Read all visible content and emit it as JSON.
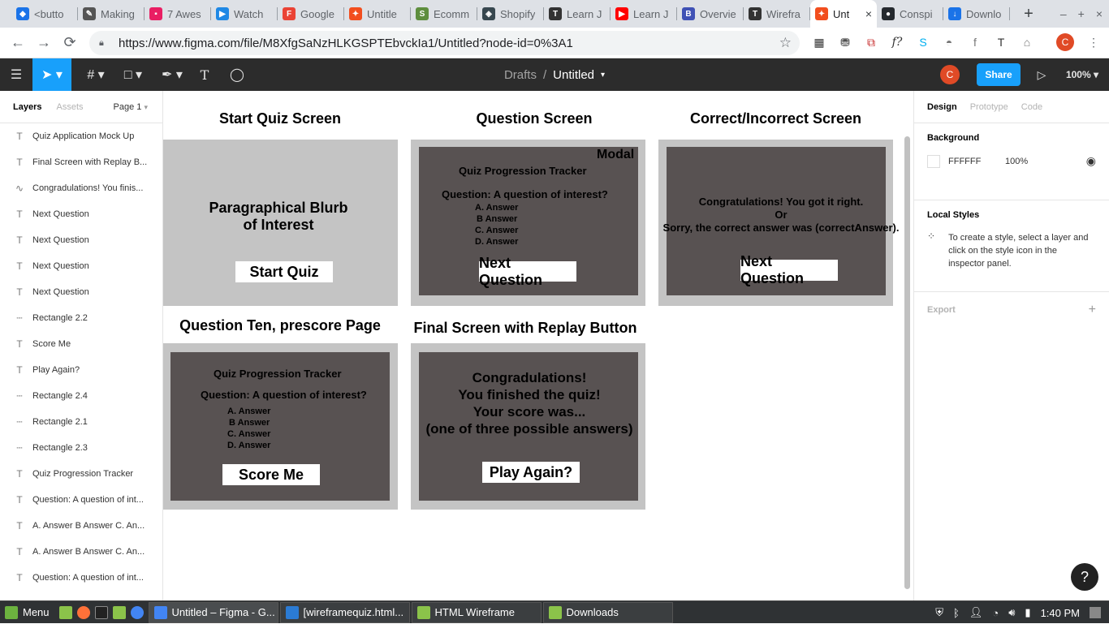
{
  "browser": {
    "tabs": [
      {
        "title": "<butto",
        "color": "#1a73e8",
        "glyph": "◆"
      },
      {
        "title": "Making",
        "color": "#555555",
        "glyph": "✎"
      },
      {
        "title": "7 Awes",
        "color": "#e91e63",
        "glyph": "▪"
      },
      {
        "title": "Watch",
        "color": "#1e88e5",
        "glyph": "▶"
      },
      {
        "title": "Google",
        "color": "#ea4335",
        "glyph": "F"
      },
      {
        "title": "Untitle",
        "color": "#f24e1e",
        "glyph": "✦"
      },
      {
        "title": "Ecomm",
        "color": "#5e8e3e",
        "glyph": "S"
      },
      {
        "title": "Shopify",
        "color": "#37474f",
        "glyph": "◈"
      },
      {
        "title": "Learn J",
        "color": "#333333",
        "glyph": "T"
      },
      {
        "title": "Learn J",
        "color": "#ff0000",
        "glyph": "▶"
      },
      {
        "title": "Overvie",
        "color": "#3f51b5",
        "glyph": "B"
      },
      {
        "title": "Wirefra",
        "color": "#333333",
        "glyph": "T"
      },
      {
        "title": "Unt",
        "color": "#f24e1e",
        "glyph": "✦",
        "active": true
      },
      {
        "title": "Conspi",
        "color": "#24292e",
        "glyph": "●"
      },
      {
        "title": "Downlo",
        "color": "#1a73e8",
        "glyph": "↓"
      }
    ],
    "url": "https://www.figma.com/file/M8XfgSaNzHLKGSPTEbvckIa1/Untitled?node-id=0%3A1",
    "close_tab": "×",
    "new_tab": "+",
    "win_min": "–",
    "win_max": "+",
    "win_close": "×"
  },
  "figma": {
    "breadcrumb_drafts": "Drafts",
    "breadcrumb_sep": "/",
    "file_name": "Untitled",
    "avatar_letter": "C",
    "share_label": "Share",
    "zoom": "100%"
  },
  "left_panel": {
    "tab_layers": "Layers",
    "tab_assets": "Assets",
    "page": "Page 1",
    "layers": [
      {
        "type": "text",
        "name": "Quiz Application Mock Up"
      },
      {
        "type": "text",
        "name": "Final Screen with Replay B..."
      },
      {
        "type": "vector",
        "name": "Congradulations! You finis..."
      },
      {
        "type": "text",
        "name": "Next Question"
      },
      {
        "type": "text",
        "name": "Next Question"
      },
      {
        "type": "text",
        "name": "Next Question"
      },
      {
        "type": "text",
        "name": "Next Question"
      },
      {
        "type": "rect",
        "name": "Rectangle 2.2"
      },
      {
        "type": "text",
        "name": "Score Me"
      },
      {
        "type": "text",
        "name": "Play Again?"
      },
      {
        "type": "rect",
        "name": "Rectangle 2.4"
      },
      {
        "type": "rect",
        "name": "Rectangle 2.1"
      },
      {
        "type": "rect",
        "name": "Rectangle 2.3"
      },
      {
        "type": "text",
        "name": "Quiz Progression Tracker"
      },
      {
        "type": "text",
        "name": "Question: A question of int..."
      },
      {
        "type": "text",
        "name": "A. Answer B Answer C. An..."
      },
      {
        "type": "text",
        "name": "A. Answer B Answer C. An..."
      },
      {
        "type": "text",
        "name": "Question: A question of int..."
      }
    ]
  },
  "canvas": {
    "start": {
      "title": "Start Quiz Screen",
      "blurb_line1": "Paragraphical Blurb",
      "blurb_line2": "of Interest",
      "button": "Start Quiz"
    },
    "question": {
      "title": "Question Screen",
      "modal": "Modal",
      "tracker": "Quiz Progression Tracker",
      "question": "Question: A question of interest?",
      "answers": [
        "A. Answer",
        "B Answer",
        "C. Answer",
        "D. Answer"
      ],
      "button": "Next Question"
    },
    "correct": {
      "title": "Correct/Incorrect Screen",
      "line1": "Congratulations! You got it right.",
      "line2": "Or",
      "line3": "Sorry, the correct answer was (correctAnswer).",
      "button": "Next Question"
    },
    "ten": {
      "title": "Question Ten, prescore Page",
      "tracker": "Quiz Progression Tracker",
      "question": "Question: A question of interest?",
      "answers": [
        "A. Answer",
        "B Answer",
        "C. Answer",
        "D. Answer"
      ],
      "button": "Score Me"
    },
    "final": {
      "title": "Final Screen with Replay Button",
      "line1": "Congradulations!",
      "line2": "You finished the quiz!",
      "line3": "Your score was...",
      "line4": "(one of three possible answers)",
      "button": "Play Again?"
    }
  },
  "right_panel": {
    "tab_design": "Design",
    "tab_prototype": "Prototype",
    "tab_code": "Code",
    "background_label": "Background",
    "bg_hex": "FFFFFF",
    "bg_opacity": "100%",
    "local_styles_label": "Local Styles",
    "local_styles_hint": "To create a style, select a layer and click on the style icon in the inspector panel.",
    "export_label": "Export",
    "export_add": "+"
  },
  "help_label": "?",
  "taskbar": {
    "menu": "Menu",
    "windows": [
      {
        "title": "Untitled – Figma - G...",
        "active": true,
        "color": "#4285f4"
      },
      {
        "title": "[wireframequiz.html...",
        "active": false,
        "color": "#2b7bd4"
      },
      {
        "title": "HTML Wireframe",
        "active": false,
        "color": "#8bc34a"
      },
      {
        "title": "Downloads",
        "active": false,
        "color": "#8bc34a"
      }
    ],
    "clock": "1:40 PM"
  }
}
